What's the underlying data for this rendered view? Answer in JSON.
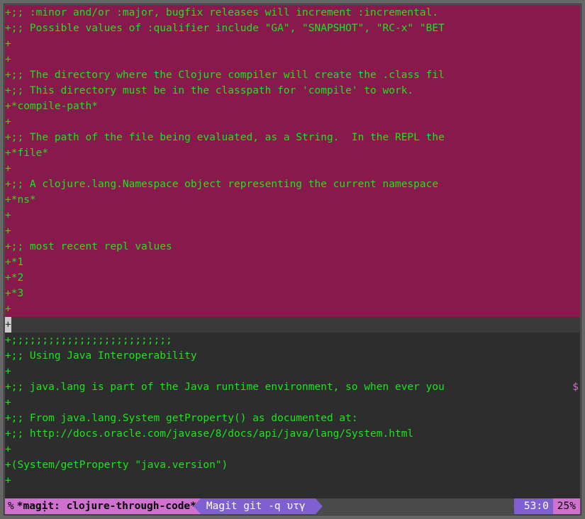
{
  "diff": {
    "region_lines": [
      ";; :minor and/or :major, bugfix releases will increment :incremental.",
      ";; Possible values of :qualifier include \"GA\", \"SNAPSHOT\", \"RC-x\" \"BET",
      "",
      "",
      ";; The directory where the Clojure compiler will create the .class fil",
      ";; This directory must be in the classpath for 'compile' to work.",
      "*compile-path*",
      "",
      ";; The path of the file being evaluated, as a String.  In the REPL the",
      "*file*",
      "",
      ";; A clojure.lang.Namespace object representing the current namespace",
      "*ns*",
      "",
      "",
      ";; most recent repl values",
      "*1",
      "*2",
      "*3",
      ""
    ],
    "post_lines": [
      ";;;;;;;;;;;;;;;;;;;;;;;;;;",
      ";; Using Java Interoperability",
      "",
      ";; java.lang is part of the Java runtime environment, so when ever you",
      "",
      ";; From java.lang.System getProperty() as documented at:",
      ";; http://docs.oracle.com/javase/8/docs/api/java/lang/System.html",
      "",
      "(System/getProperty \"java.version\")",
      ""
    ],
    "trunc_rows": [
      1,
      4,
      8,
      24
    ]
  },
  "modeline": {
    "status": "% ",
    "buffer": "*magịt: clojure-through-code*",
    "mode": "Magit git -q   υτγ",
    "pos": "53:0",
    "pct": "25%"
  }
}
